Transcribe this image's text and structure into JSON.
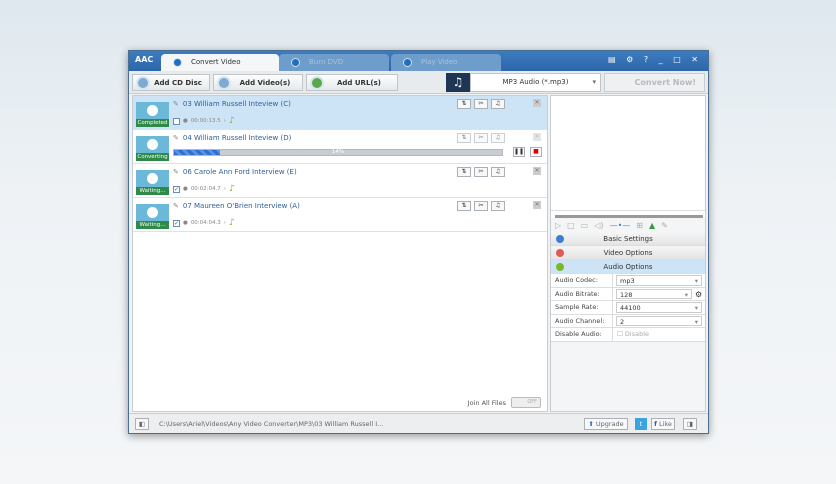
{
  "app": {
    "logo": "AAC"
  },
  "tabs": [
    {
      "label": "Convert Video"
    },
    {
      "label": "Burn DVD"
    },
    {
      "label": "Play Video"
    }
  ],
  "window_controls": "▤ ⚙ ? _ □ ✕",
  "toolbar": {
    "add_cd": "Add CD Disc",
    "add_videos": "Add Video(s)",
    "add_url": "Add URL(s)",
    "format": "MP3 Audio (*.mp3)",
    "convert": "Convert Now!"
  },
  "files": [
    {
      "name": "03 William Russell Inteview (C)",
      "status": "Completed",
      "duration": "00:00:13.5",
      "checked": false
    },
    {
      "name": "04 William Russell Inteview (D)",
      "status": "Converting",
      "progress_percent": 14,
      "progress_label": "14%"
    },
    {
      "name": "06 Carole Ann Ford Interview (E)",
      "status": "Waiting...",
      "duration": "00:02:04.7",
      "checked": true
    },
    {
      "name": "07 Maureen O'Brien Interview (A)",
      "status": "Waiting...",
      "duration": "00:04:04.3",
      "checked": true
    }
  ],
  "join": {
    "label": "Join All Files",
    "toggle": "OFF"
  },
  "sections": {
    "basic": "Basic Settings",
    "video": "Video Options",
    "audio": "Audio Options"
  },
  "props": [
    {
      "key": "Audio Codec:",
      "value": "mp3"
    },
    {
      "key": "Audio Bitrate:",
      "value": "128"
    },
    {
      "key": "Sample Rate:",
      "value": "44100"
    },
    {
      "key": "Audio Channel:",
      "value": "2"
    },
    {
      "key": "Disable Audio:",
      "value": "Disable"
    }
  ],
  "status": {
    "path": "C:\\Users\\Ariel\\Videos\\Any Video Converter\\MP3\\03 William Russell I...",
    "upgrade": "Upgrade",
    "like": "Like"
  }
}
